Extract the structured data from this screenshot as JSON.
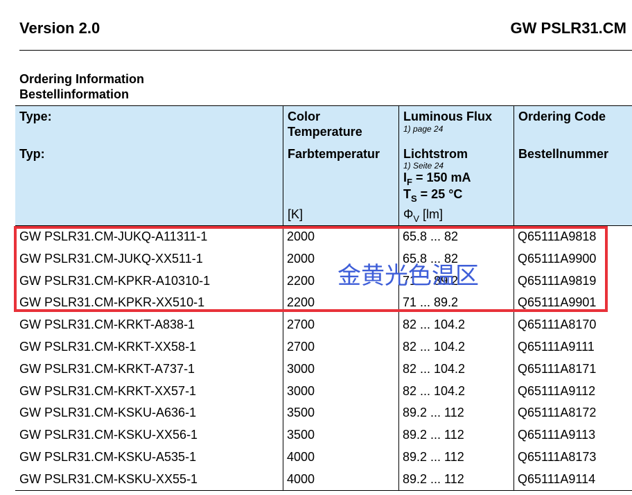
{
  "header": {
    "version": "Version 2.0",
    "product": "GW PSLR31.CM"
  },
  "section": {
    "title_en": "Ordering Information",
    "title_de": "Bestellinformation"
  },
  "table": {
    "headers": {
      "type_en": "Type:",
      "type_de": "Typ:",
      "color_en_1": "Color",
      "color_en_2": "Temperature",
      "color_de": "Farbtemperatur",
      "color_unit": "[K]",
      "flux_en": "Luminous Flux",
      "flux_note_en": "1) page 24",
      "flux_de": "Lichtstrom",
      "flux_note_de": "1) Seite 24",
      "flux_cond1_label": "I",
      "flux_cond1_sub": "F",
      "flux_cond1_val": " = 150 mA",
      "flux_cond2_label": "T",
      "flux_cond2_sub": "S",
      "flux_cond2_val": " = 25 °C",
      "flux_unit_symbol": "Φ",
      "flux_unit_sub": "V",
      "flux_unit": " [lm]",
      "code_en": "Ordering Code",
      "code_de": "Bestellnummer"
    },
    "rows": [
      {
        "type": "GW PSLR31.CM-JUKQ-A11311-1",
        "cct": "2000",
        "flux": "65.8 ... 82",
        "code": "Q65111A9818"
      },
      {
        "type": "GW PSLR31.CM-JUKQ-XX511-1",
        "cct": "2000",
        "flux": "65.8 ... 82",
        "code": "Q65111A9900"
      },
      {
        "type": "GW PSLR31.CM-KPKR-A10310-1",
        "cct": "2200",
        "flux": "71 ... 89.2",
        "code": "Q65111A9819"
      },
      {
        "type": "GW PSLR31.CM-KPKR-XX510-1",
        "cct": "2200",
        "flux": "71 ... 89.2",
        "code": "Q65111A9901"
      },
      {
        "type": "GW PSLR31.CM-KRKT-A838-1",
        "cct": "2700",
        "flux": "82 ... 104.2",
        "code": "Q65111A8170"
      },
      {
        "type": "GW PSLR31.CM-KRKT-XX58-1",
        "cct": "2700",
        "flux": "82 ... 104.2",
        "code": "Q65111A9111"
      },
      {
        "type": "GW PSLR31.CM-KRKT-A737-1",
        "cct": "3000",
        "flux": "82 ... 104.2",
        "code": "Q65111A8171"
      },
      {
        "type": "GW PSLR31.CM-KRKT-XX57-1",
        "cct": "3000",
        "flux": "82 ... 104.2",
        "code": "Q65111A9112"
      },
      {
        "type": "GW PSLR31.CM-KSKU-A636-1",
        "cct": "3500",
        "flux": "89.2 ... 112",
        "code": "Q65111A8172"
      },
      {
        "type": "GW PSLR31.CM-KSKU-XX56-1",
        "cct": "3500",
        "flux": "89.2 ... 112",
        "code": "Q65111A9113"
      },
      {
        "type": "GW PSLR31.CM-KSKU-A535-1",
        "cct": "4000",
        "flux": "89.2 ... 112",
        "code": "Q65111A8173"
      },
      {
        "type": "GW PSLR31.CM-KSKU-XX55-1",
        "cct": "4000",
        "flux": "89.2 ... 112",
        "code": "Q65111A9114"
      }
    ]
  },
  "annotation": {
    "text": "金黄光色温区",
    "color": "#3e5ed8",
    "box_color": "#e8323a"
  }
}
